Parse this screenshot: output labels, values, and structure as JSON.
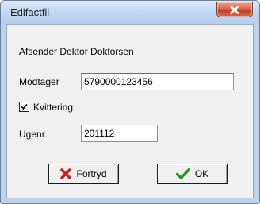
{
  "window": {
    "title": "Edifactfil",
    "close_icon": "close-x-icon"
  },
  "form": {
    "sender_text": "Afsender Doktor Doktorsen",
    "recipient_label": "Modtager",
    "recipient_value": "5790000123456",
    "receipt_label": "Kvittering",
    "receipt_checked": true,
    "week_label": "Ugenr.",
    "week_value": "201112"
  },
  "buttons": {
    "cancel_label": "Fortryd",
    "cancel_icon": "red-x-icon",
    "ok_label": "OK",
    "ok_icon": "green-check-icon"
  },
  "colors": {
    "close_button": "#c43b21",
    "cancel_icon": "#cc1f1a",
    "ok_icon": "#1a9a1a"
  }
}
